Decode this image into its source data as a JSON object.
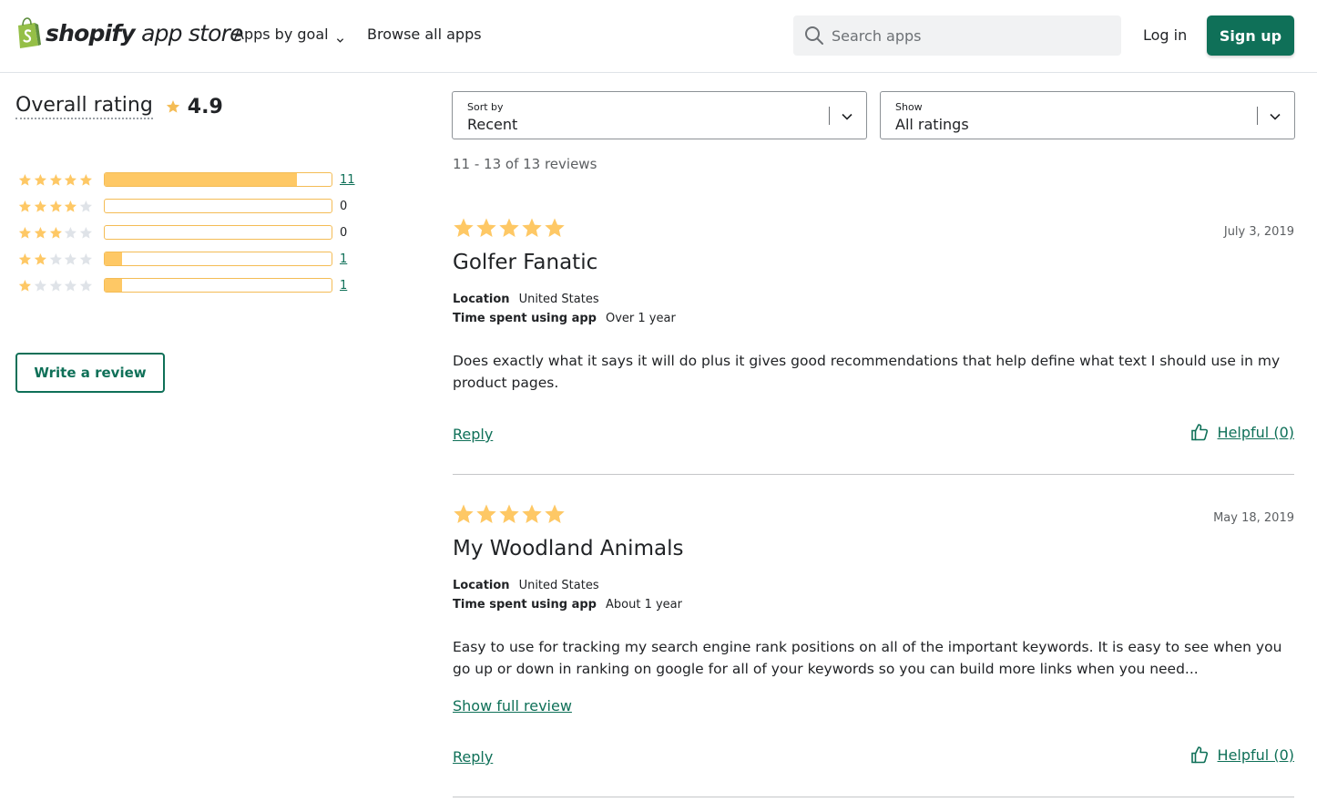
{
  "colors": {
    "brand_green": "#0f7058",
    "star_gold": "#fec865",
    "star_empty": "#dfe3e8",
    "logo_green": "#95bf47"
  },
  "header": {
    "logo_word1": "shopify",
    "logo_word2": "app store",
    "nav": {
      "goal": "Apps by goal",
      "browse": "Browse all apps"
    },
    "search_placeholder": "Search apps",
    "login": "Log in",
    "signup": "Sign up"
  },
  "rating": {
    "title": "Overall rating",
    "value": "4.9",
    "distribution": [
      {
        "stars": 5,
        "count": "11",
        "fraction": 0.846,
        "link": true
      },
      {
        "stars": 4,
        "count": "0",
        "fraction": 0,
        "link": false
      },
      {
        "stars": 3,
        "count": "0",
        "fraction": 0,
        "link": false
      },
      {
        "stars": 2,
        "count": "1",
        "fraction": 0.077,
        "link": true
      },
      {
        "stars": 1,
        "count": "1",
        "fraction": 0.077,
        "link": true
      }
    ],
    "write_review": "Write a review"
  },
  "filters": {
    "sort": {
      "label": "Sort by",
      "value": "Recent"
    },
    "show": {
      "label": "Show",
      "value": "All ratings"
    }
  },
  "review_count": "11 - 13 of 13 reviews",
  "reviews": [
    {
      "rating": 5,
      "title": "Golfer Fanatic",
      "date": "July 3, 2019",
      "location_label": "Location",
      "location": "United States",
      "time_label": "Time spent using app",
      "time": "Over 1 year",
      "body": "Does exactly what it says it will do plus it gives good recommendations that help define what text I should use in my product pages.",
      "show_full": "",
      "reply": "Reply",
      "helpful": "Helpful (0)"
    },
    {
      "rating": 5,
      "title": "My Woodland Animals",
      "date": "May 18, 2019",
      "location_label": "Location",
      "location": "United States",
      "time_label": "Time spent using app",
      "time": "About 1 year",
      "body": "Easy to use for tracking my search engine rank positions on all of the important keywords. It is easy to see when you go up or down in ranking on google for all of your keywords so you can build more links when you need...",
      "show_full": "Show full review",
      "reply": "Reply",
      "helpful": "Helpful (0)"
    }
  ]
}
